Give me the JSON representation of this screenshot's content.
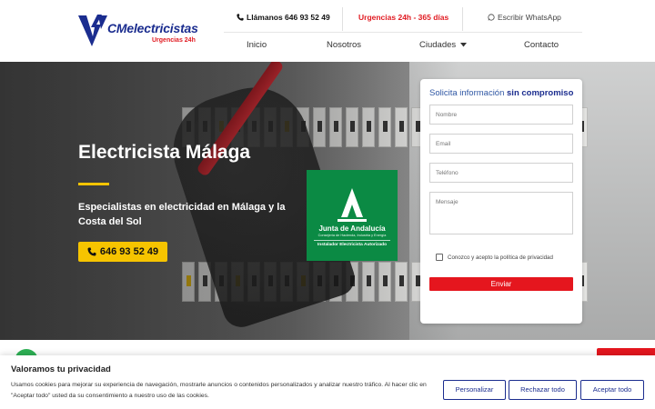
{
  "brand": {
    "name": "CMelectricistas",
    "tagline": "Urgencias 24h",
    "colors": {
      "primary": "#1b2d8f",
      "accent": "#e11b22",
      "highlight": "#f6c400",
      "junta": "#0b8a44",
      "whatsapp": "#2eb155"
    }
  },
  "topbar": {
    "call_label": "Llámanos 646 93 52 49",
    "call_icon": "phone-icon",
    "urgent_label": "Urgencias 24h - 365 días",
    "whatsapp_label": "Escribir WhatsApp",
    "whatsapp_icon": "whatsapp-icon"
  },
  "nav": {
    "items": [
      "Inicio",
      "Nosotros",
      "Ciudades",
      "Contacto"
    ],
    "dropdown_icon": "caret-down-icon"
  },
  "hero": {
    "title": "Electricista Málaga",
    "subtitle": "Especialistas en electricidad en Málaga y la Costa del Sol",
    "cta_phone": "646 93 52 49",
    "cta_icon": "phone-icon"
  },
  "badge": {
    "name": "Junta de Andalucía",
    "department": "Consejería de Hacienda, Industria y Energía",
    "caption": "Instalador Electricista Autorizado"
  },
  "form": {
    "title_plain": "Solicita información",
    "title_bold": "sin compromiso",
    "fields": {
      "name": "Nombre",
      "email": "Email",
      "phone": "Teléfono",
      "message": "Mensaje"
    },
    "privacy_label": "Conozco y acepto la política de privacidad",
    "submit_label": "Enviar"
  },
  "cookie": {
    "title": "Valoramos tu privacidad",
    "text": "Usamos cookies para mejorar su experiencia de navegación, mostrarle anuncios o contenidos personalizados y analizar nuestro tráfico. Al hacer clic en \"Aceptar todo\" usted da su consentimiento a nuestro uso de las cookies.",
    "customize_label": "Personalizar",
    "reject_label": "Rechazar todo",
    "accept_label": "Aceptar todo"
  }
}
